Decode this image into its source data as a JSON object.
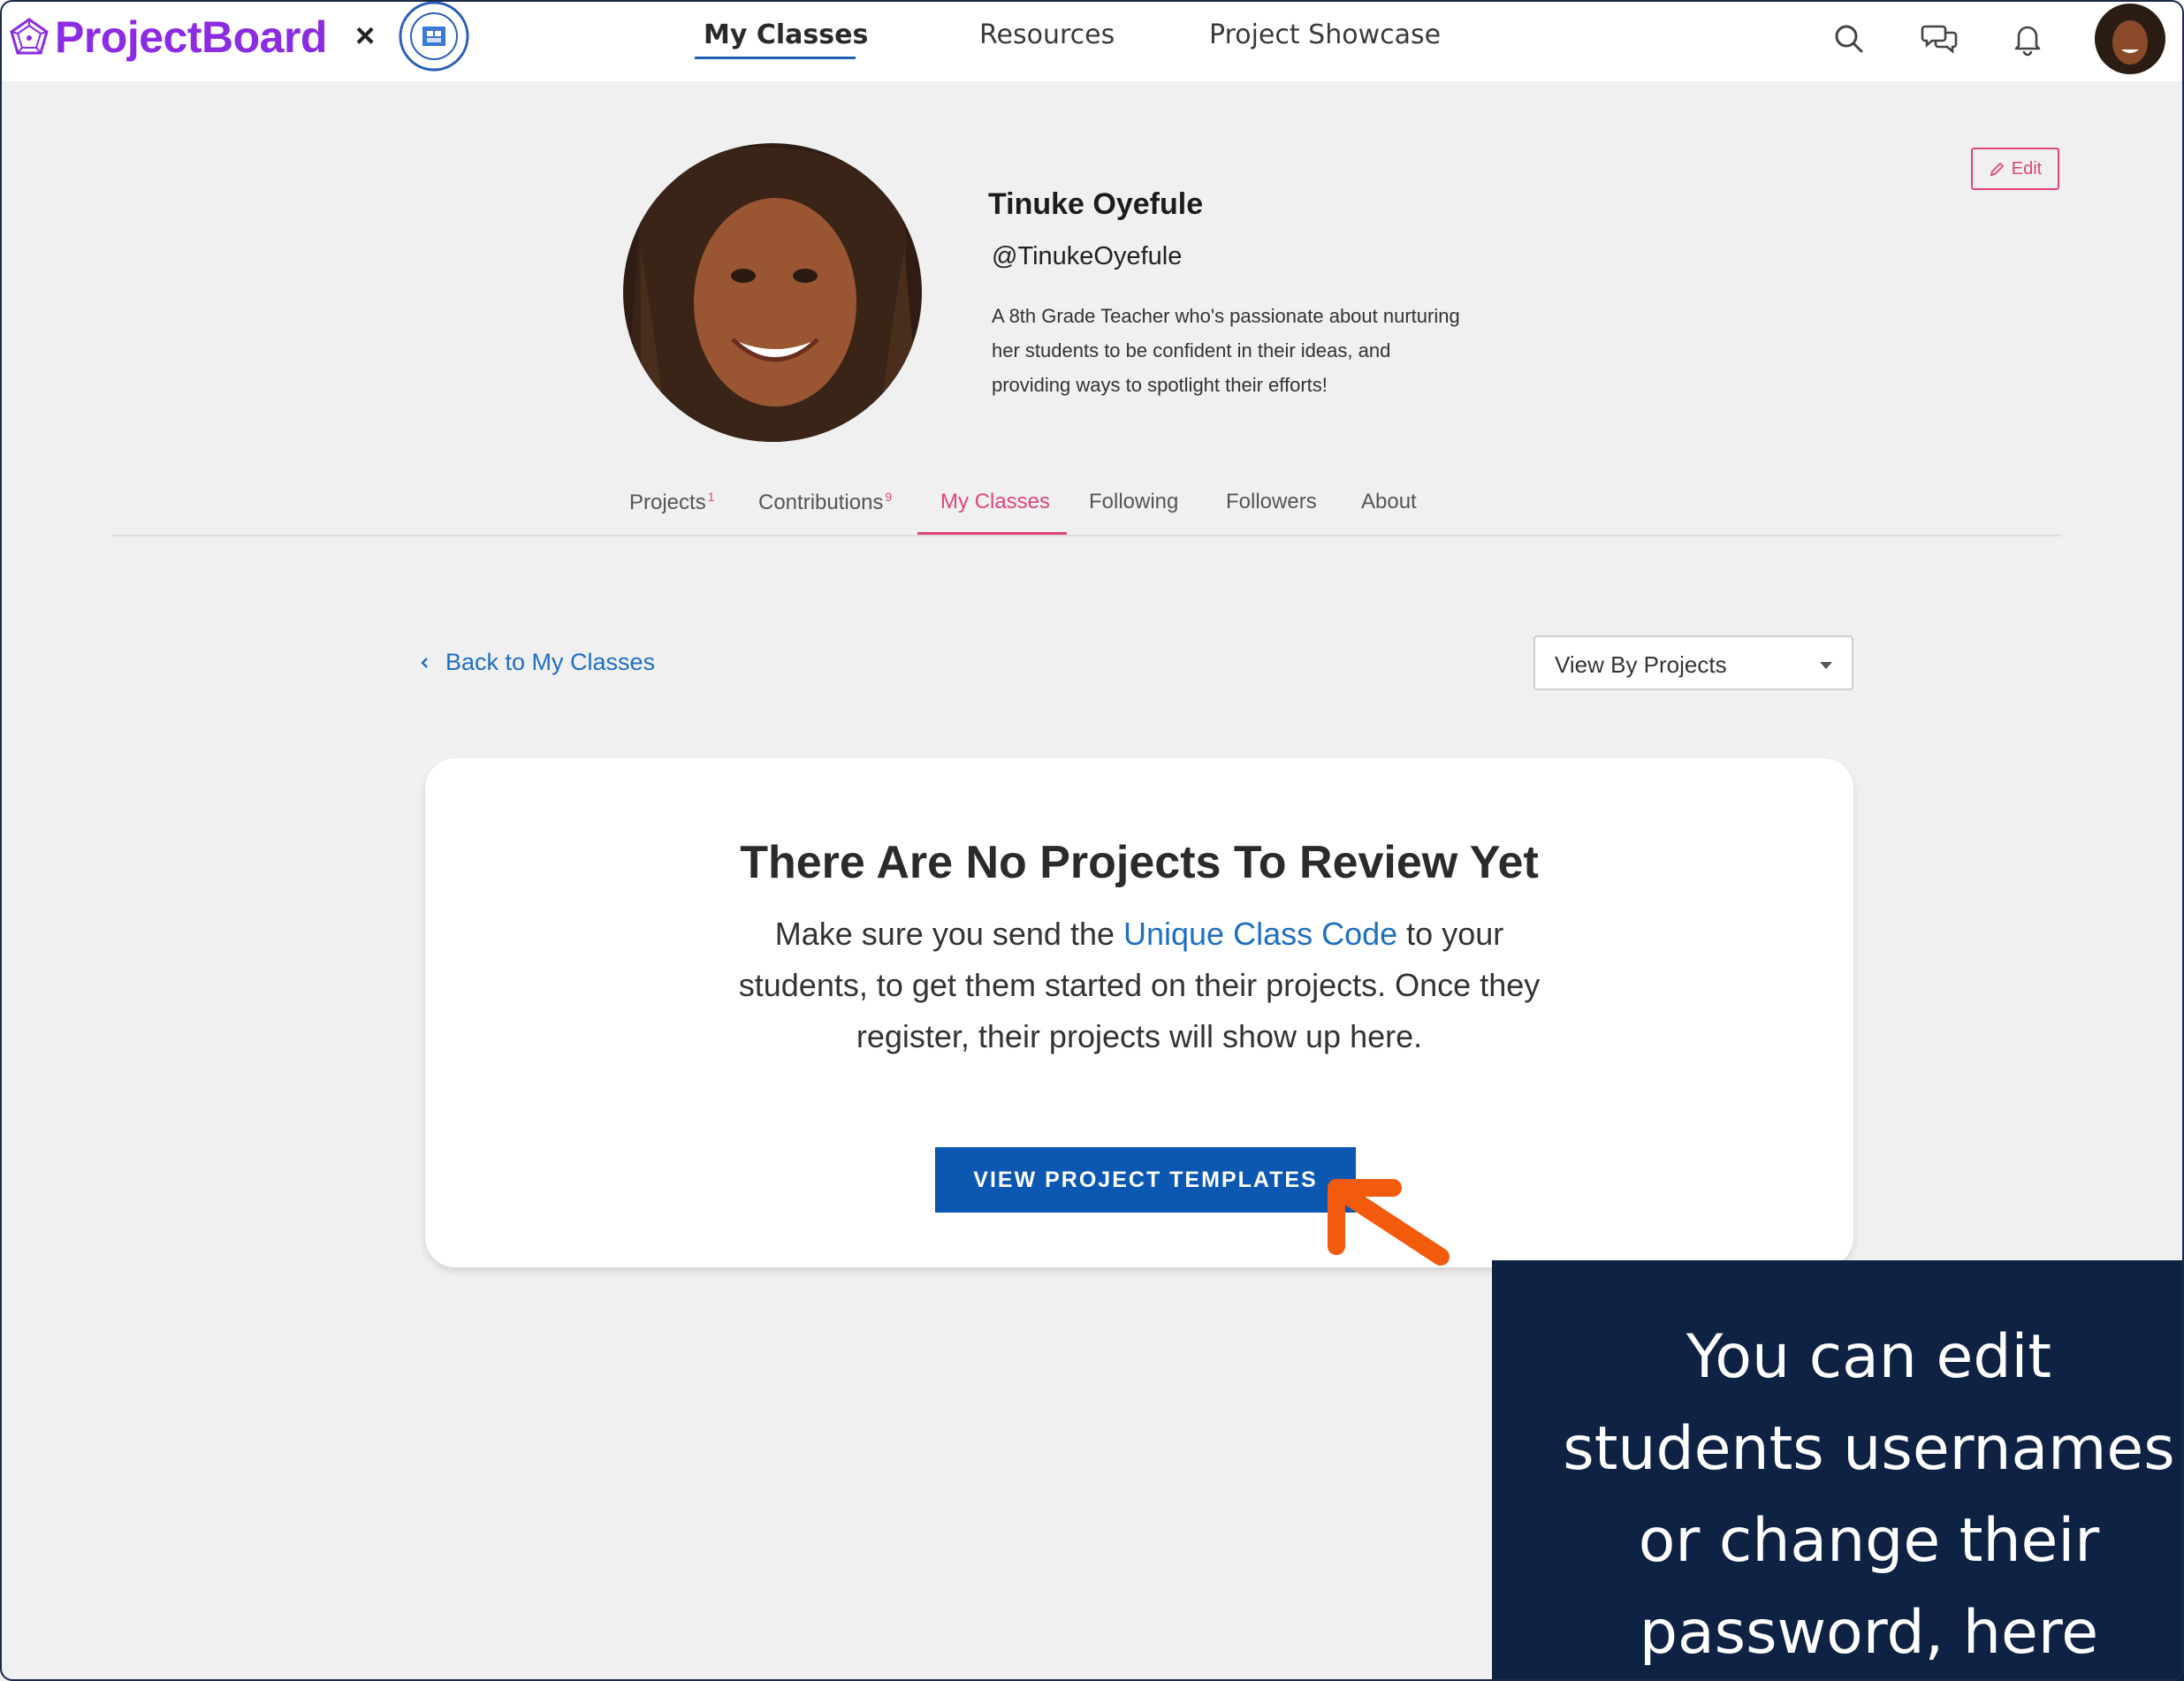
{
  "brand": {
    "name": "ProjectBoard",
    "separator": "×",
    "logo_icon": "pentagon-network-icon",
    "partner_seal": "ohio-academy-of-science-seal",
    "accent": "#8b2be2"
  },
  "nav": {
    "items": [
      {
        "label": "My Classes",
        "active": true
      },
      {
        "label": "Resources",
        "active": false
      },
      {
        "label": "Project Showcase",
        "active": false
      }
    ],
    "icons": [
      "search-icon",
      "chat-icon",
      "bell-icon",
      "avatar"
    ]
  },
  "profile": {
    "name": "Tinuke Oyefule",
    "handle": "@TinukeOyefule",
    "bio_lines": [
      "A 8th Grade Teacher who's passionate about nurturing",
      "her students to be confident in their ideas, and",
      "providing ways to spotlight their efforts!"
    ],
    "edit_label": "Edit"
  },
  "tabs": {
    "items": [
      {
        "label": "Projects",
        "count": "1"
      },
      {
        "label": "Contributions",
        "count": "9"
      },
      {
        "label": "My Classes",
        "count": ""
      },
      {
        "label": "Following",
        "count": ""
      },
      {
        "label": "Followers",
        "count": ""
      },
      {
        "label": "About",
        "count": ""
      }
    ],
    "active_index": 2,
    "active_color": "#e0457b"
  },
  "controls": {
    "back_label": "Back to My Classes",
    "view_select": "View By Projects"
  },
  "empty_state": {
    "title": "There Are No Projects To Review Yet",
    "body_before": "Make sure you send the ",
    "body_link": "Unique Class Code",
    "body_after": " to your students, to get them started on their projects. Once they register, their projects will show up here.",
    "cta_label": "VIEW PROJECT TEMPLATES",
    "cta_color": "#0b57b1"
  },
  "annotation": {
    "arrow_color": "#f25a0c",
    "callout_lines": [
      "You can edit",
      "students usernames",
      "or change their",
      "password, here"
    ],
    "callout_bg": "#0e2244"
  }
}
